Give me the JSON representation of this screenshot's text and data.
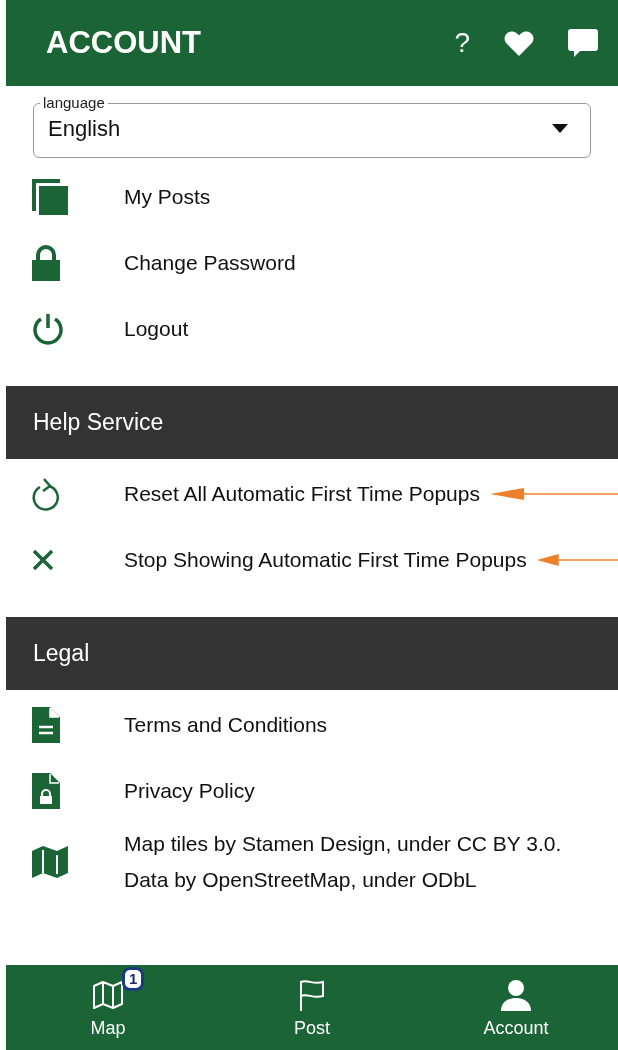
{
  "header": {
    "title": "ACCOUNT",
    "help": "?"
  },
  "language": {
    "label": "language",
    "value": "English"
  },
  "account_items": [
    {
      "label": "My Posts"
    },
    {
      "label": "Change Password"
    },
    {
      "label": "Logout"
    }
  ],
  "sections": [
    {
      "title": "Help Service",
      "items": [
        {
          "label": "Reset All Automatic First Time Popups",
          "annotated": true
        },
        {
          "label": "Stop Showing Automatic First Time Popups",
          "annotated": true
        }
      ]
    },
    {
      "title": "Legal",
      "items": [
        {
          "label": "Terms and Conditions",
          "annotated": false
        },
        {
          "label": "Privacy Policy",
          "annotated": false
        },
        {
          "label": "Map tiles by Stamen Design, under CC BY 3.0. Data by OpenStreetMap, under ODbL",
          "annotated": false
        }
      ]
    }
  ],
  "bottom_nav": [
    {
      "label": "Map",
      "badge": "1"
    },
    {
      "label": "Post"
    },
    {
      "label": "Account"
    }
  ]
}
